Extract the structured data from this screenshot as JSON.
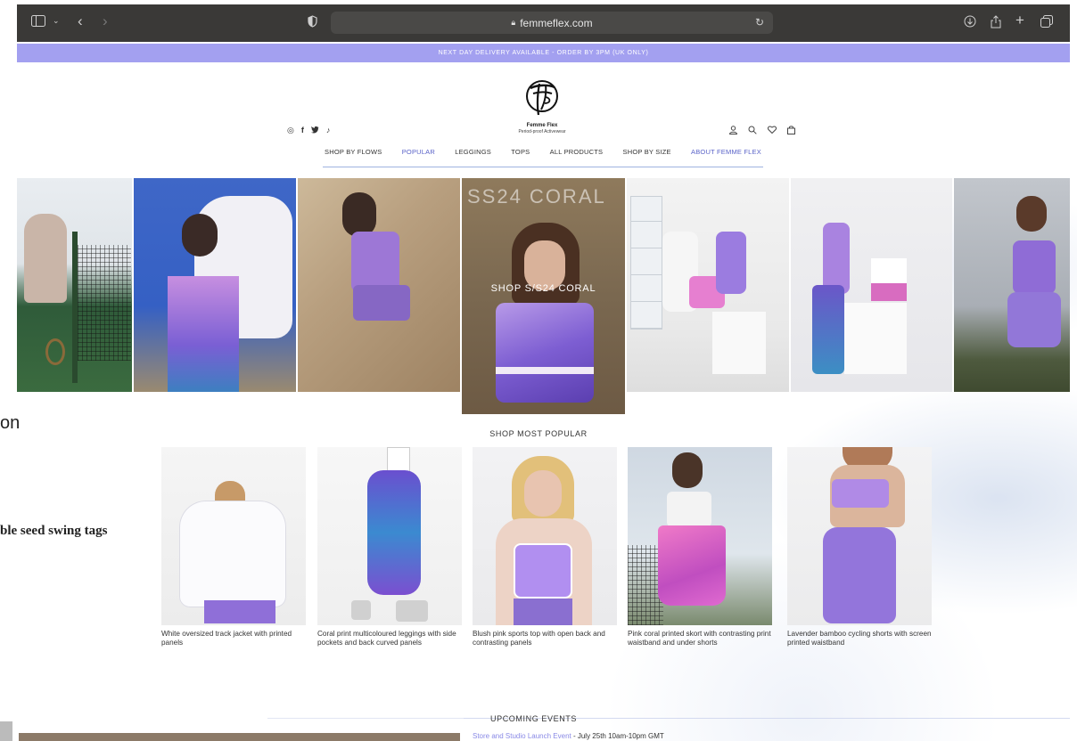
{
  "side_text": {
    "line1": "on",
    "line2": "ble seed swing tags"
  },
  "browser": {
    "url": "femmeflex.com"
  },
  "promo": {
    "text": "NEXT DAY DELIVERY AVAILABLE - ORDER BY 3PM (UK ONLY)"
  },
  "brand": {
    "name": "Femme Flex",
    "tagline": "Period-proof Activewear"
  },
  "social_icons": [
    "instagram-icon",
    "facebook-icon",
    "twitter-icon",
    "tiktok-icon"
  ],
  "user_icons": [
    "account-icon",
    "search-icon",
    "wishlist-icon",
    "bag-icon"
  ],
  "nav": {
    "items": [
      {
        "label": "SHOP BY FLOWS",
        "active": false
      },
      {
        "label": "POPULAR",
        "active": true
      },
      {
        "label": "LEGGINGS",
        "active": false
      },
      {
        "label": "TOPS",
        "active": false
      },
      {
        "label": "ALL PRODUCTS",
        "active": false
      },
      {
        "label": "SHOP BY SIZE",
        "active": false
      },
      {
        "label": "ABOUT FEMME FLEX",
        "active": false
      }
    ]
  },
  "hero": {
    "overlay_label": "SHOP S/S24 CORAL",
    "big_text": "SS24 CORAL"
  },
  "popular": {
    "title": "SHOP MOST POPULAR",
    "products": [
      {
        "caption": "White oversized track jacket with printed panels"
      },
      {
        "caption": "Coral print multicoloured leggings with side pockets and back curved panels"
      },
      {
        "caption": "Blush pink sports top with open back and contrasting panels"
      },
      {
        "caption": "Pink coral printed skort with contrasting print waistband and under shorts"
      },
      {
        "caption": "Lavender bamboo cycling shorts with screen printed waistband"
      }
    ]
  },
  "events": {
    "title": "UPCOMING EVENTS",
    "item_link": "Store and Studio Launch Event",
    "item_detail": " - July 25th 10am-10pm GMT"
  }
}
